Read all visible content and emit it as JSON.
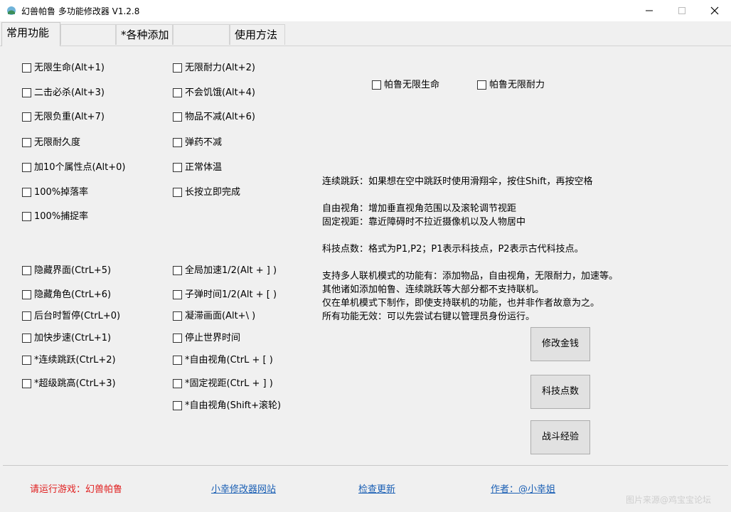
{
  "window": {
    "title": "幻兽帕鲁 多功能修改器 V1.2.8",
    "accent": "#1a5fb4"
  },
  "tabs": [
    "常用功能",
    "*各种添加",
    "使用方法"
  ],
  "col1_top": [
    "无限生命(Alt+1)",
    "二击必杀(Alt+3)",
    "无限负重(Alt+7)",
    "无限耐久度",
    "加10个属性点(Alt+0)",
    "100%掉落率",
    "100%捕捉率"
  ],
  "col2_top": [
    "无限耐力(Alt+2)",
    "不会饥饿(Alt+4)",
    "物品不减(Alt+6)",
    "弹药不减",
    "正常体温",
    "长按立即完成"
  ],
  "pal": [
    "帕鲁无限生命",
    "帕鲁无限耐力"
  ],
  "col1_bottom": [
    "隐藏界面(CtrL+5)",
    "隐藏角色(CtrL+6)",
    "后台时暂停(CtrL+0)",
    "加快步速(CtrL+1)",
    "*连续跳跃(CtrL+2)",
    "*超级跳高(CtrL+3)"
  ],
  "col2_bottom": [
    "全局加速1/2(Alt + ] )",
    "子弹时间1/2(Alt + [ )",
    "凝滞画面(Alt+\\ )",
    "停止世界时间",
    "*自由视角(CtrL + [ )",
    "*固定视距(CtrL + ] )",
    "*自由视角(Shift+滚轮)"
  ],
  "info": [
    "连续跳跃：如果想在空中跳跃时使用滑翔伞，按住Shift，再按空格",
    "自由视角：增加垂直视角范围以及滚轮调节视距",
    "固定视距：靠近障碍时不拉近摄像机以及人物居中",
    "科技点数：格式为P1,P2；P1表示科技点，P2表示古代科技点。",
    "支持多人联机模式的功能有：添加物品，自由视角，无限耐力，加速等。",
    "其他诸如添加帕鲁、连续跳跃等大部分都不支持联机。",
    "仅在单机模式下制作，即使支持联机的功能，也并非作者故意为之。",
    "所有功能无效：可以先尝试右键以管理员身份运行。"
  ],
  "buttons": [
    "修改金钱",
    "科技点数",
    "战斗经验"
  ],
  "footer": {
    "status": "请运行游戏：幻兽帕鲁",
    "site": "小幸修改器网站",
    "update": "检查更新",
    "author": "作者：@小幸姐",
    "status_color": "#e02020"
  },
  "watermark": "图片来源@鸡宝宝论坛"
}
